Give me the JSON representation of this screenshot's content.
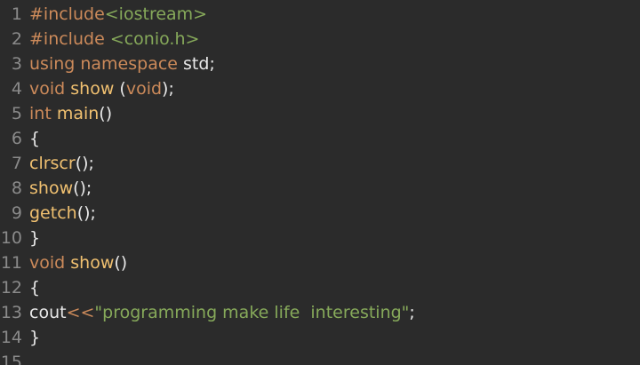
{
  "lines": [
    {
      "num": "1",
      "tokens": [
        {
          "t": "#include",
          "c": "dir"
        },
        {
          "t": "<iostream>",
          "c": "str"
        }
      ]
    },
    {
      "num": "2",
      "tokens": [
        {
          "t": "#include ",
          "c": "dir"
        },
        {
          "t": "<conio.h>",
          "c": "str"
        }
      ]
    },
    {
      "num": "3",
      "tokens": [
        {
          "t": "using namespace ",
          "c": "kw"
        },
        {
          "t": "std;",
          "c": "pl"
        }
      ]
    },
    {
      "num": "4",
      "tokens": [
        {
          "t": "void ",
          "c": "kw"
        },
        {
          "t": "show ",
          "c": "fn"
        },
        {
          "t": "(",
          "c": "pl"
        },
        {
          "t": "void",
          "c": "kw"
        },
        {
          "t": ");",
          "c": "pl"
        }
      ]
    },
    {
      "num": "5",
      "tokens": [
        {
          "t": "int ",
          "c": "kw"
        },
        {
          "t": "main",
          "c": "fn"
        },
        {
          "t": "()",
          "c": "pl"
        }
      ]
    },
    {
      "num": "6",
      "tokens": [
        {
          "t": "{",
          "c": "pl"
        }
      ]
    },
    {
      "num": "7",
      "tokens": [
        {
          "t": "clrscr",
          "c": "fn"
        },
        {
          "t": "();",
          "c": "pl"
        }
      ]
    },
    {
      "num": "8",
      "tokens": [
        {
          "t": "show",
          "c": "fn"
        },
        {
          "t": "();",
          "c": "pl"
        }
      ]
    },
    {
      "num": "9",
      "tokens": [
        {
          "t": "getch",
          "c": "fn"
        },
        {
          "t": "();",
          "c": "pl"
        }
      ]
    },
    {
      "num": "10",
      "tokens": [
        {
          "t": "}",
          "c": "pl"
        }
      ]
    },
    {
      "num": "11",
      "tokens": [
        {
          "t": "void ",
          "c": "kw"
        },
        {
          "t": "show",
          "c": "fn"
        },
        {
          "t": "()",
          "c": "pl"
        }
      ]
    },
    {
      "num": "12",
      "tokens": [
        {
          "t": "{",
          "c": "pl"
        }
      ]
    },
    {
      "num": "13",
      "tokens": [
        {
          "t": "cout",
          "c": "pl"
        },
        {
          "t": "<<",
          "c": "op"
        },
        {
          "t": "\"programming make life  interesting\"",
          "c": "str"
        },
        {
          "t": ";",
          "c": "pl"
        }
      ]
    },
    {
      "num": "14",
      "tokens": [
        {
          "t": "}",
          "c": "pl"
        }
      ]
    },
    {
      "num": "15",
      "tokens": []
    }
  ],
  "colors": {
    "background": "#2b2b2b",
    "line_number": "#8a8a8a",
    "keyword": "#cc8a5a",
    "function": "#f0c070",
    "string": "#86a95a",
    "plain": "#e8e8e8"
  }
}
